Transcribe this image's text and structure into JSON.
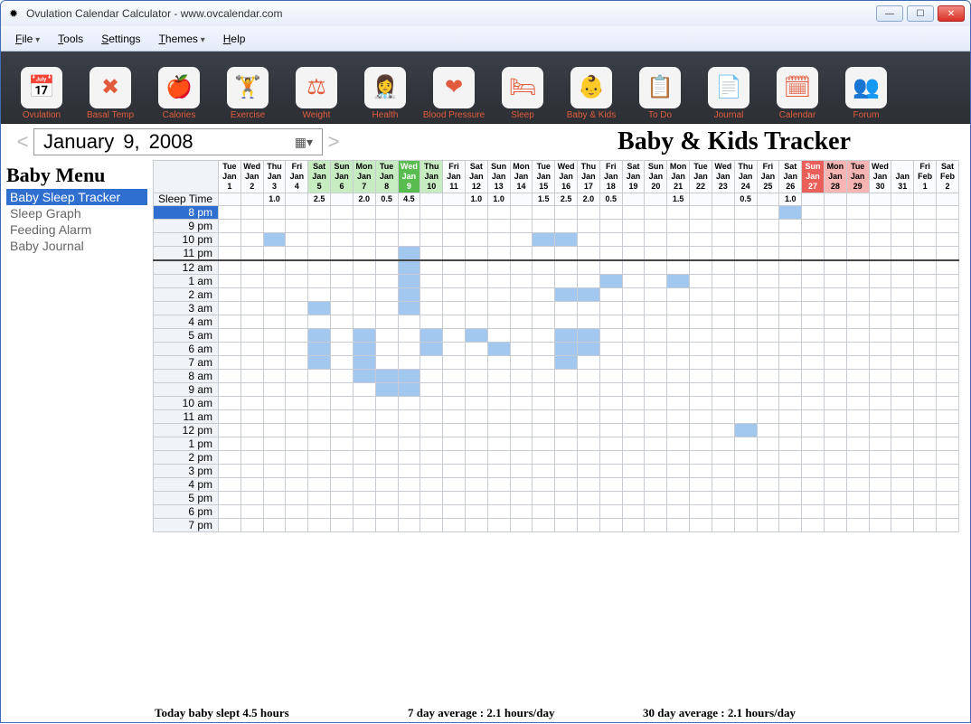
{
  "window": {
    "title": "Ovulation Calendar Calculator - www.ovcalendar.com"
  },
  "menu": {
    "items": [
      "File",
      "Tools",
      "Settings",
      "Themes",
      "Help"
    ],
    "dropdowns": [
      true,
      false,
      false,
      true,
      false
    ]
  },
  "toolbar": [
    {
      "label": "Ovulation",
      "icon": "📅"
    },
    {
      "label": "Basal Temp",
      "icon": "✖"
    },
    {
      "label": "Calories",
      "icon": "🍎"
    },
    {
      "label": "Exercise",
      "icon": "🏋"
    },
    {
      "label": "Weight",
      "icon": "⚖"
    },
    {
      "label": "Health",
      "icon": "👩‍⚕️"
    },
    {
      "label": "Blood Pressure",
      "icon": "❤"
    },
    {
      "label": "Sleep",
      "icon": "🛏"
    },
    {
      "label": "Baby & Kids",
      "icon": "👶"
    },
    {
      "label": "To Do",
      "icon": "📋"
    },
    {
      "label": "Journal",
      "icon": "📄"
    },
    {
      "label": "Calendar",
      "icon": "🗓"
    },
    {
      "label": "Forum",
      "icon": "👥"
    }
  ],
  "date": {
    "month": "January",
    "day": "9,",
    "year": "2008"
  },
  "page_title": "Baby & Kids Tracker",
  "sidebar": {
    "heading": "Baby Menu",
    "items": [
      "Baby Sleep Tracker",
      "Sleep Graph",
      "Feeding Alarm",
      "Baby Journal"
    ],
    "selected": 0
  },
  "grid": {
    "rowhead_label": "Sleep Time",
    "columns": [
      {
        "dow": "Tue",
        "mon": "Jan",
        "d": "1"
      },
      {
        "dow": "Wed",
        "mon": "Jan",
        "d": "2"
      },
      {
        "dow": "Thu",
        "mon": "Jan",
        "d": "3",
        "val": "1.0"
      },
      {
        "dow": "Fri",
        "mon": "Jan",
        "d": "4"
      },
      {
        "dow": "Sat",
        "mon": "Jan",
        "d": "5",
        "val": "2.5",
        "cls": "bg-lightgreen"
      },
      {
        "dow": "Sun",
        "mon": "Jan",
        "d": "6",
        "cls": "bg-lightgreen"
      },
      {
        "dow": "Mon",
        "mon": "Jan",
        "d": "7",
        "val": "2.0",
        "cls": "bg-lightgreen"
      },
      {
        "dow": "Tue",
        "mon": "Jan",
        "d": "8",
        "val": "0.5",
        "cls": "bg-lightgreen"
      },
      {
        "dow": "Wed",
        "mon": "Jan",
        "d": "9",
        "val": "4.5",
        "cls": "bg-green"
      },
      {
        "dow": "Thu",
        "mon": "Jan",
        "d": "10",
        "cls": "bg-lightgreen"
      },
      {
        "dow": "Fri",
        "mon": "Jan",
        "d": "11"
      },
      {
        "dow": "Sat",
        "mon": "Jan",
        "d": "12",
        "val": "1.0"
      },
      {
        "dow": "Sun",
        "mon": "Jan",
        "d": "13",
        "val": "1.0"
      },
      {
        "dow": "Mon",
        "mon": "Jan",
        "d": "14"
      },
      {
        "dow": "Tue",
        "mon": "Jan",
        "d": "15",
        "val": "1.5"
      },
      {
        "dow": "Wed",
        "mon": "Jan",
        "d": "16",
        "val": "2.5"
      },
      {
        "dow": "Thu",
        "mon": "Jan",
        "d": "17",
        "val": "2.0"
      },
      {
        "dow": "Fri",
        "mon": "Jan",
        "d": "18",
        "val": "0.5"
      },
      {
        "dow": "Sat",
        "mon": "Jan",
        "d": "19"
      },
      {
        "dow": "Sun",
        "mon": "Jan",
        "d": "20"
      },
      {
        "dow": "Mon",
        "mon": "Jan",
        "d": "21",
        "val": "1.5"
      },
      {
        "dow": "Tue",
        "mon": "Jan",
        "d": "22"
      },
      {
        "dow": "Wed",
        "mon": "Jan",
        "d": "23"
      },
      {
        "dow": "Thu",
        "mon": "Jan",
        "d": "24",
        "val": "0.5"
      },
      {
        "dow": "Fri",
        "mon": "Jan",
        "d": "25"
      },
      {
        "dow": "Sat",
        "mon": "Jan",
        "d": "26",
        "val": "1.0"
      },
      {
        "dow": "Sun",
        "mon": "Jan",
        "d": "27",
        "cls": "bg-red"
      },
      {
        "dow": "Mon",
        "mon": "Jan",
        "d": "28",
        "cls": "bg-pink"
      },
      {
        "dow": "Tue",
        "mon": "Jan",
        "d": "29",
        "cls": "bg-pink"
      },
      {
        "dow": "Wed",
        "mon": "Jan",
        "d": "30"
      },
      {
        "dow": "",
        "mon": "Jan",
        "d": "31"
      },
      {
        "dow": "Fri",
        "mon": "Feb",
        "d": "1"
      },
      {
        "dow": "Sat",
        "mon": "Feb",
        "d": "2"
      }
    ],
    "rows": [
      "8 pm",
      "9 pm",
      "10 pm",
      "11 pm",
      "12 am",
      "1 am",
      "2 am",
      "3 am",
      "4 am",
      "5 am",
      "6 am",
      "7 am",
      "8 am",
      "9 am",
      "10 am",
      "11 am",
      "12 pm",
      "1 pm",
      "2 pm",
      "3 pm",
      "4 pm",
      "5 pm",
      "6 pm",
      "7 pm"
    ],
    "selected_row": 0,
    "fills": {
      "0": [
        25
      ],
      "2": [
        2,
        14,
        15
      ],
      "3": [
        8
      ],
      "4": [
        8
      ],
      "5": [
        8,
        17,
        20
      ],
      "6": [
        8,
        15,
        16
      ],
      "7": [
        4,
        8
      ],
      "9": [
        4,
        6,
        9,
        11,
        15,
        16
      ],
      "10": [
        4,
        6,
        9,
        12,
        15,
        16
      ],
      "11": [
        4,
        6,
        15
      ],
      "12": [
        6,
        7,
        8
      ],
      "13": [
        7,
        8
      ],
      "16": [
        23
      ]
    }
  },
  "status": {
    "today": "Today baby slept 4.5 hours",
    "avg7": "7 day average : 2.1 hours/day",
    "avg30": "30 day average : 2.1 hours/day"
  }
}
